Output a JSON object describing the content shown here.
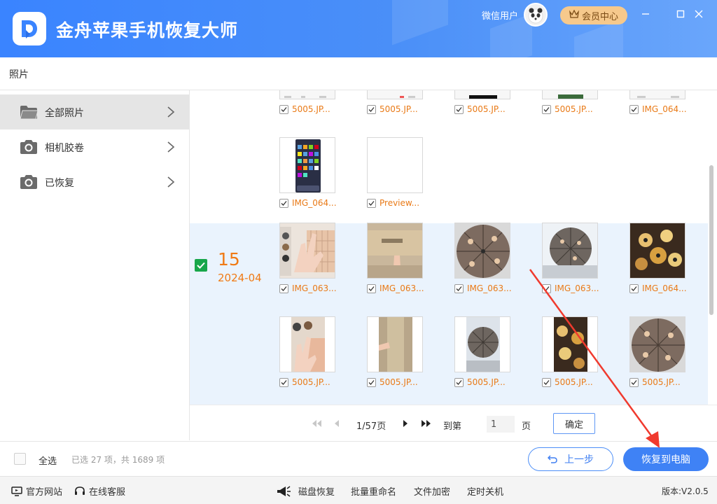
{
  "app": {
    "title": "金舟苹果手机恢复大师",
    "user_name": "微信用户",
    "member_label": "会员中心"
  },
  "window": {
    "minimize": "–",
    "maximize": "□",
    "close": "×"
  },
  "section_title": "照片",
  "sidebar": {
    "items": [
      {
        "label": "全部照片",
        "icon": "folder-icon",
        "active": true
      },
      {
        "label": "相机胶卷",
        "icon": "camera-icon",
        "active": false
      },
      {
        "label": "已恢复",
        "icon": "camera-icon",
        "active": false
      }
    ]
  },
  "group": {
    "day": "15",
    "year_month": "2024-04",
    "checked": true
  },
  "rows": [
    {
      "items": [
        "5005.JP...",
        "5005.JP...",
        "5005.JP...",
        "5005.JP...",
        "IMG_064..."
      ]
    },
    {
      "items": [
        "IMG_064...",
        "Preview..."
      ]
    },
    {
      "items": [
        "IMG_063...",
        "IMG_063...",
        "IMG_063...",
        "IMG_063...",
        "IMG_064..."
      ]
    },
    {
      "items": [
        "5005.JP...",
        "5005.JP...",
        "5005.JP...",
        "5005.JP...",
        "5005.JP..."
      ]
    }
  ],
  "pager": {
    "page_info": "1/57页",
    "goto_label": "到第",
    "page_value": "1",
    "page_suffix": "页",
    "confirm_label": "确定"
  },
  "actions": {
    "select_all": "全选",
    "status": "已选 27 项，共 1689 项",
    "prev_label": "上一步",
    "recover_label": "恢复到电脑"
  },
  "footer": {
    "website": "官方网站",
    "support": "在线客服",
    "disk_recovery": "磁盘恢复",
    "batch_rename": "批量重命名",
    "file_encrypt": "文件加密",
    "timer_shutdown": "定时关机",
    "version": "版本:V2.0.5"
  },
  "colors": {
    "header": "#3a84ff",
    "accent": "#3f82f5",
    "filename": "#e97a17",
    "group_bg": "#eaf3fd",
    "check_green": "#17a64a",
    "member_bg": "#f6c98c"
  }
}
